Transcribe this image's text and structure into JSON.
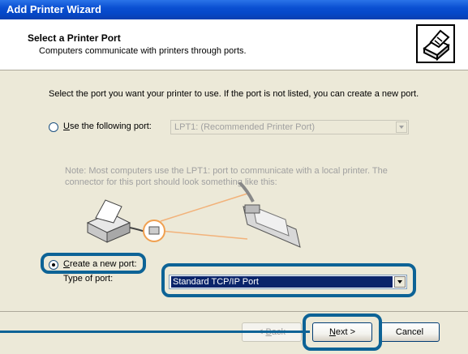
{
  "window": {
    "title": "Add Printer Wizard"
  },
  "header": {
    "title": "Select a Printer Port",
    "subtitle": "Computers communicate with printers through ports.",
    "icon": "printer-wizard-icon"
  },
  "main": {
    "instruction": "Select the port you want your printer to use.  If the port is not listed, you can create a new port.",
    "use_port": {
      "label_prefix": "U",
      "label_rest": "se the following port:",
      "selected": false,
      "combo_value": "LPT1: (Recommended Printer Port)"
    },
    "note": "Note: Most computers use the LPT1: port to communicate with a local printer. The connector for this port should look something like this:",
    "create_port": {
      "label_prefix": "C",
      "label_rest": "reate a new port:",
      "selected": true,
      "type_label": "Type of port:",
      "combo_value": "Standard TCP/IP Port"
    }
  },
  "footer": {
    "back_label_prefix": "< ",
    "back_label_u": "B",
    "back_label_rest": "ack",
    "next_label_u": "N",
    "next_label_rest": "ext >",
    "cancel_label": "Cancel"
  },
  "colors": {
    "highlight": "#0d6396",
    "title_bar": "#0a4fd2",
    "selection": "#0a246a"
  }
}
